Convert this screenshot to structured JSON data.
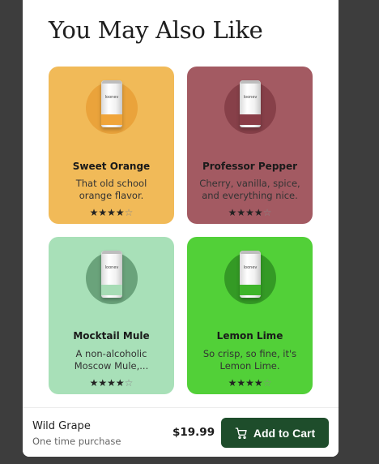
{
  "section": {
    "title": "You May Also Like"
  },
  "products": [
    {
      "name": "Sweet Orange",
      "desc_line1": "That old school",
      "desc_line2": "orange flavor.",
      "rating": 4,
      "bg": "#f1ba58",
      "circle": "#eaa33b",
      "band": "#f0a53a",
      "brand": "loonev"
    },
    {
      "name": "Professor Pepper",
      "desc_line1": "Cherry, vanilla, spice,",
      "desc_line2": "and everything nice.",
      "rating": 4,
      "bg": "#a35a62",
      "circle": "#874049",
      "band": "#8a3d47",
      "brand": "loonev"
    },
    {
      "name": "Mocktail Mule",
      "desc_line1": "A non-alcoholic",
      "desc_line2": "Moscow Mule,...",
      "rating": 4,
      "bg": "#a8e0b8",
      "circle": "#6aa37b",
      "band": "#a7dcb5",
      "brand": "loonev"
    },
    {
      "name": "Lemon Lime",
      "desc_line1": "So crisp, so fine, it's",
      "desc_line2": "Lemon Lime.",
      "rating": 4,
      "bg": "#52d038",
      "circle": "#349a25",
      "band": "#3fb52a",
      "brand": "loonev"
    }
  ],
  "footer": {
    "product_name": "Wild Grape",
    "purchase_type": "One time purchase",
    "price": "$19.99",
    "add_to_cart_label": "Add to Cart"
  },
  "icons": {
    "cart": "cart-icon",
    "star": "star-icon"
  }
}
